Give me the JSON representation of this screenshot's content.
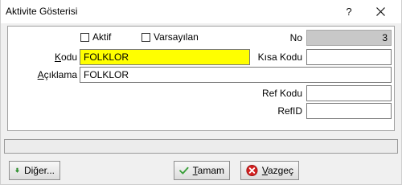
{
  "window": {
    "title": "Aktivite Gösterisi",
    "help_label": "?",
    "close_icon": "close-icon"
  },
  "form": {
    "aktif": {
      "label": "Aktif",
      "checked": false
    },
    "varsayilan": {
      "label": "Varsayılan",
      "checked": false
    },
    "no": {
      "label": "No",
      "value": "3"
    },
    "kodu": {
      "label_k": "K",
      "label_rest": "odu",
      "value": "FOLKLOR"
    },
    "kisa_kodu": {
      "label": "Kısa Kodu",
      "value": ""
    },
    "aciklama": {
      "label_a": "A",
      "label_rest": "çıklama",
      "value": "FOLKLOR"
    },
    "ref_kodu": {
      "label": "Ref Kodu",
      "value": ""
    },
    "ref_id": {
      "label": "RefID",
      "value": ""
    }
  },
  "buttons": {
    "diger": {
      "label_main": "Diğer",
      "label_tail": "...",
      "icon": "arrow-down-icon",
      "color": "#2e9a2e"
    },
    "tamam": {
      "label_u": "T",
      "label_rest": "amam",
      "icon": "checkmark-icon",
      "color": "#3aa03a"
    },
    "vazgec": {
      "label_u": "V",
      "label_rest": "azgeç",
      "icon": "cancel-icon",
      "color": "#d32020"
    }
  }
}
